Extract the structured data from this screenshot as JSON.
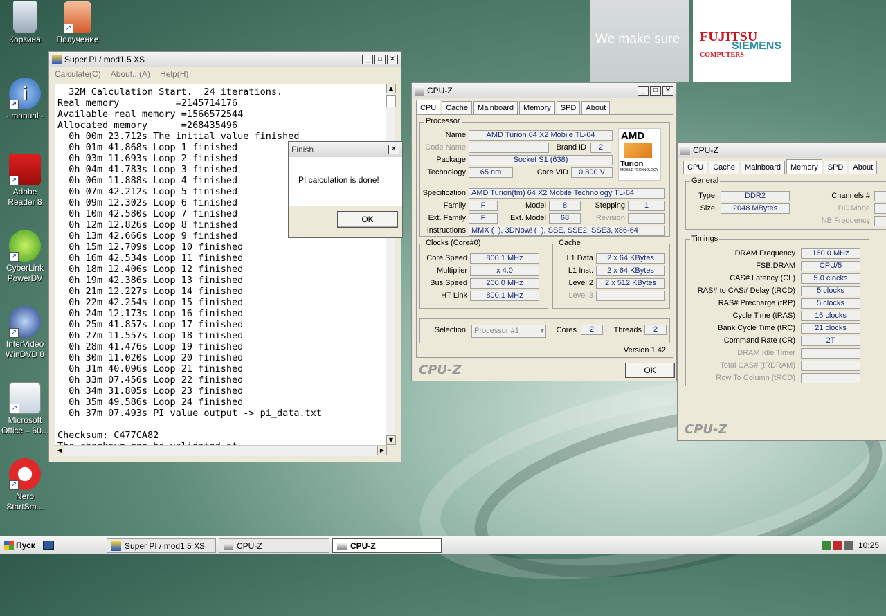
{
  "desktop": {
    "brand_tagline": "We make sure",
    "brand_name_1": "FUJITSU",
    "brand_name_1b": "COMPUTERS",
    "brand_name_2": "SIEMENS",
    "icons": [
      {
        "label": "Корзина"
      },
      {
        "label": "Получение"
      },
      {
        "label": "- manual -"
      },
      {
        "label": "Adobe Reader 8"
      },
      {
        "label": "CyberLink PowerDV"
      },
      {
        "label": "InterVideo WinDVD 8"
      },
      {
        "label": "Microsoft Office – 60..."
      },
      {
        "label": "Nero StartSm..."
      }
    ]
  },
  "superpi": {
    "title": "Super PI / mod1.5 XS",
    "menu": [
      "Calculate(C)",
      "About...(A)",
      "Help(H)"
    ],
    "console": "  32M Calculation Start.  24 iterations.\nReal memory          =2145714176\nAvailable real memory =1566572544\nAllocated memory      =268435496\n  0h 00m 23.712s The initial value finished\n  0h 01m 41.868s Loop 1 finished\n  0h 03m 11.693s Loop 2 finished\n  0h 04m 41.783s Loop 3 finished\n  0h 06m 11.888s Loop 4 finished\n  0h 07m 42.212s Loop 5 finished\n  0h 09m 12.302s Loop 6 finished\n  0h 10m 42.580s Loop 7 finished\n  0h 12m 12.826s Loop 8 finished\n  0h 13m 42.666s Loop 9 finished\n  0h 15m 12.709s Loop 10 finished\n  0h 16m 42.534s Loop 11 finished\n  0h 18m 12.406s Loop 12 finished\n  0h 19m 42.386s Loop 13 finished\n  0h 21m 12.227s Loop 14 finished\n  0h 22m 42.254s Loop 15 finished\n  0h 24m 12.173s Loop 16 finished\n  0h 25m 41.857s Loop 17 finished\n  0h 27m 11.557s Loop 18 finished\n  0h 28m 41.476s Loop 19 finished\n  0h 30m 11.020s Loop 20 finished\n  0h 31m 40.096s Loop 21 finished\n  0h 33m 07.456s Loop 22 finished\n  0h 34m 31.805s Loop 23 finished\n  0h 35m 49.586s Loop 24 finished\n  0h 37m 07.493s PI value output -> pi_data.txt\n\nChecksum: C477CA82\nThe checksum can be validated at"
  },
  "finish_dialog": {
    "title": "Finish",
    "message": "PI calculation is done!",
    "ok": "OK"
  },
  "cpuz1": {
    "title": "CPU-Z",
    "tabs": [
      "CPU",
      "Cache",
      "Mainboard",
      "Memory",
      "SPD",
      "About"
    ],
    "processor_label": "Processor",
    "name_label": "Name",
    "name": "AMD Turion 64 X2 Mobile TL-64",
    "codename_label": "Code Name",
    "codename": "",
    "brandid_label": "Brand ID",
    "brandid": "2",
    "package_label": "Package",
    "package": "Socket S1 (638)",
    "technology_label": "Technology",
    "technology": "65 nm",
    "corevid_label": "Core VID",
    "corevid": "0.800 V",
    "spec_label": "Specification",
    "spec": "AMD Turion(tm) 64 X2 Mobile Technology TL-64",
    "family_label": "Family",
    "family": "F",
    "model_label": "Model",
    "model": "8",
    "stepping_label": "Stepping",
    "stepping": "1",
    "extfamily_label": "Ext. Family",
    "extfamily": "F",
    "extmodel_label": "Ext. Model",
    "extmodel": "68",
    "revision_label": "Revision",
    "revision": "",
    "instructions_label": "Instructions",
    "instructions": "MMX (+), 3DNow! (+), SSE, SSE2, SSE3, x86-64",
    "logo_top": "AMD",
    "logo_mid": "Turion",
    "logo_sub": "MOBILE TECHNOLOGY",
    "clocks_label": "Clocks (Core#0)",
    "corespeed_label": "Core Speed",
    "corespeed": "800.1 MHz",
    "multiplier_label": "Multiplier",
    "multiplier": "x 4.0",
    "busspeed_label": "Bus Speed",
    "busspeed": "200.0 MHz",
    "htlink_label": "HT Link",
    "htlink": "800.1 MHz",
    "cache_label": "Cache",
    "l1data_label": "L1 Data",
    "l1data": "2 x 64 KBytes",
    "l1inst_label": "L1 Inst.",
    "l1inst": "2 x 64 KBytes",
    "level2_label": "Level 2",
    "level2": "2 x 512 KBytes",
    "level3_label": "Level 3",
    "level3": "",
    "selection_label": "Selection",
    "selection": "Processor #1",
    "cores_label": "Cores",
    "cores": "2",
    "threads_label": "Threads",
    "threads": "2",
    "version": "Version 1.42",
    "logo": "CPU-Z",
    "ok": "OK"
  },
  "cpuz2": {
    "title": "CPU-Z",
    "tabs": [
      "CPU",
      "Cache",
      "Mainboard",
      "Memory",
      "SPD",
      "About"
    ],
    "general_label": "General",
    "type_label": "Type",
    "type": "DDR2",
    "size_label": "Size",
    "size": "2048 MBytes",
    "channels_label": "Channels #",
    "dcmode_label": "DC Mode",
    "nbfreq_label": "NB Frequency",
    "timings_label": "Timings",
    "timings": [
      {
        "label": "DRAM Frequency",
        "value": "160.0 MHz",
        "disabled": false
      },
      {
        "label": "FSB:DRAM",
        "value": "CPU/5",
        "disabled": false
      },
      {
        "label": "CAS# Latency (CL)",
        "value": "5.0 clocks",
        "disabled": false
      },
      {
        "label": "RAS# to CAS# Delay (tRCD)",
        "value": "5 clocks",
        "disabled": false
      },
      {
        "label": "RAS# Precharge (tRP)",
        "value": "5 clocks",
        "disabled": false
      },
      {
        "label": "Cycle Time (tRAS)",
        "value": "15 clocks",
        "disabled": false
      },
      {
        "label": "Bank Cycle Time (tRC)",
        "value": "21 clocks",
        "disabled": false
      },
      {
        "label": "Command Rate (CR)",
        "value": "2T",
        "disabled": false
      },
      {
        "label": "DRAM Idle Timer",
        "value": "",
        "disabled": true
      },
      {
        "label": "Total CAS# (tRDRAM)",
        "value": "",
        "disabled": true
      },
      {
        "label": "Row To Column (tRCD)",
        "value": "",
        "disabled": true
      }
    ],
    "logo": "CPU-Z"
  },
  "taskbar": {
    "start": "Пуск",
    "items": [
      "Super PI / mod1.5 XS",
      "CPU-Z",
      "CPU-Z"
    ],
    "clock": "10:25"
  }
}
